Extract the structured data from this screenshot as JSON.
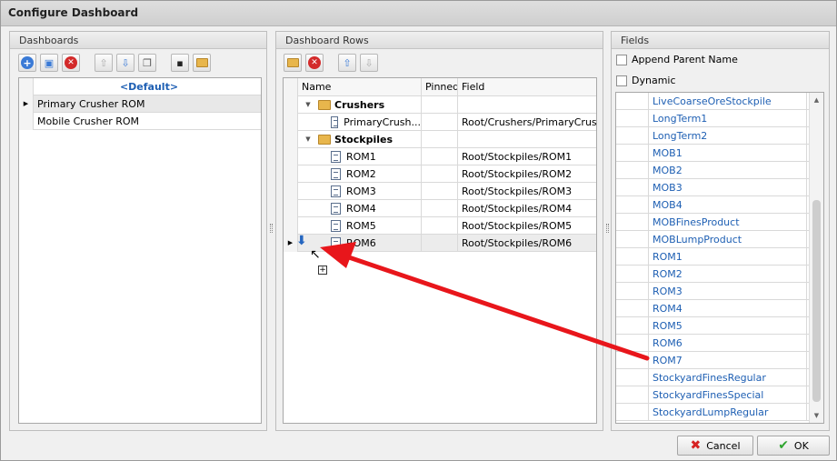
{
  "window": {
    "title": "Configure Dashboard"
  },
  "dashboards": {
    "header": "Dashboards",
    "default_label": "<Default>",
    "items": [
      "Primary Crusher ROM",
      "Mobile Crusher ROM"
    ]
  },
  "rows": {
    "header": "Dashboard Rows",
    "columns": {
      "name": "Name",
      "pinned": "Pinned",
      "field": "Field"
    },
    "groups": [
      {
        "name": "Crushers",
        "children": [
          {
            "name": "PrimaryCrush...",
            "field": "Root/Crushers/PrimaryCrus..."
          }
        ]
      },
      {
        "name": "Stockpiles",
        "children": [
          {
            "name": "ROM1",
            "field": "Root/Stockpiles/ROM1"
          },
          {
            "name": "ROM2",
            "field": "Root/Stockpiles/ROM2"
          },
          {
            "name": "ROM3",
            "field": "Root/Stockpiles/ROM3"
          },
          {
            "name": "ROM4",
            "field": "Root/Stockpiles/ROM4"
          },
          {
            "name": "ROM5",
            "field": "Root/Stockpiles/ROM5"
          },
          {
            "name": "ROM6",
            "field": "Root/Stockpiles/ROM6"
          }
        ]
      }
    ]
  },
  "fields": {
    "header": "Fields",
    "append_parent_label": "Append Parent Name",
    "dynamic_label": "Dynamic",
    "items": [
      "LiveCoarseOreStockpile",
      "LongTerm1",
      "LongTerm2",
      "MOB1",
      "MOB2",
      "MOB3",
      "MOB4",
      "MOBFinesProduct",
      "MOBLumpProduct",
      "ROM1",
      "ROM2",
      "ROM3",
      "ROM4",
      "ROM5",
      "ROM6",
      "ROM7",
      "StockyardFinesRegular",
      "StockyardFinesSpecial",
      "StockyardLumpRegular"
    ]
  },
  "buttons": {
    "cancel": "Cancel",
    "ok": "OK"
  },
  "colors": {
    "accent": "#1e5fb3",
    "arrow": "#e8161b"
  }
}
